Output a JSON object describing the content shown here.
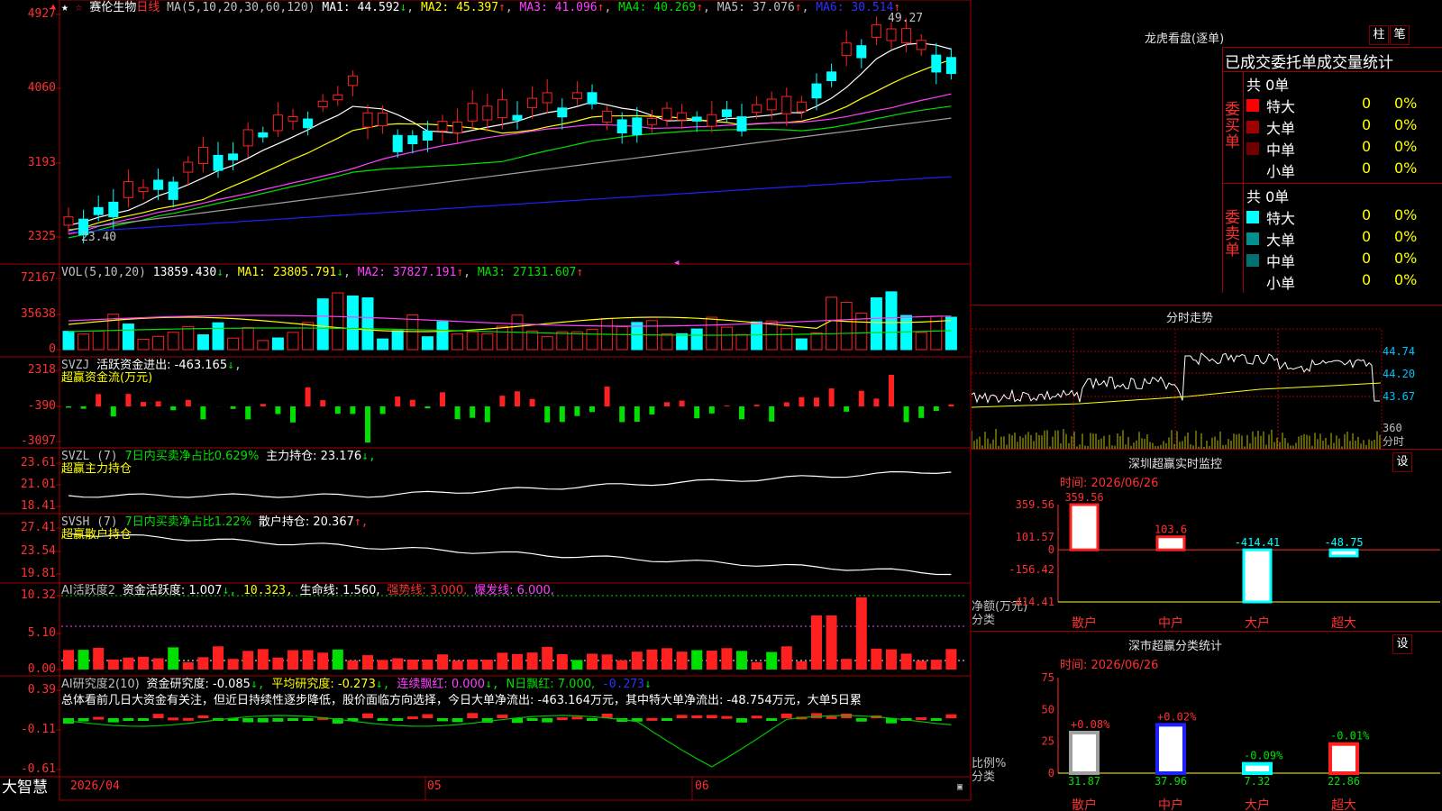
{
  "stock": {
    "name": "赛伦生物",
    "period": "日线",
    "ma_params": "MA(5,10,20,30,60,120)"
  },
  "main_header": {
    "ma1": "MA1: 44.592",
    "ma1_dir": "↓",
    "ma2": "MA2: 45.397",
    "ma2_dir": "↑",
    "ma3": "MA3: 41.096",
    "ma3_dir": "↑",
    "ma4": "MA4: 40.269",
    "ma4_dir": "↑",
    "ma5": "MA5: 37.076",
    "ma5_dir": "↑",
    "ma6": "MA6: 30.514",
    "ma6_dir": "↑",
    "high_label": "49.27",
    "low_label": "23.40"
  },
  "vol_header": {
    "params": "VOL(5,10,20)",
    "value": "13859.430",
    "dir": "↓",
    "ma1": "MA1: 23805.791",
    "ma1_dir": "↓",
    "ma2": "MA2: 37827.191",
    "ma2_dir": "↑",
    "ma3": "MA3: 27131.607",
    "ma3_dir": "↑"
  },
  "svzj_header": {
    "name": "SVZJ",
    "label": "活跃资金进出: -463.165",
    "dir": "↓",
    "sub": "超赢资金流(万元)"
  },
  "svzl_header": {
    "name": "SVZL (7)",
    "label": "7日内买卖净占比0.629%",
    "hold": "主力持仓: 23.176",
    "dir": "↓,",
    "sub": "超赢主力持仓"
  },
  "svsh_header": {
    "name": "SVSH (7)",
    "label": "7日内买卖净占比1.22%",
    "hold": "散户持仓: 20.367",
    "dir": "↑,",
    "sub": "超赢散户持仓"
  },
  "ai_header": {
    "name": "AI活跃度2",
    "a": "资金活跃度: 1.007",
    "a_dir": "↓,",
    "b": "10.323,",
    "c": "生命线: 1.560,",
    "d": "强势线: 3.000,",
    "e": "爆发线: 6.000,"
  },
  "ai2_header": {
    "name": "AI研究度2(10)",
    "a": "资金研究度: -0.085",
    "a_dir": "↓,",
    "b": "平均研究度: -0.273",
    "b_dir": "↓,",
    "c": "连续飘红: 0.000",
    "c_dir": "↓,",
    "d": "N日飘红: 7.000,",
    "e": "-0.273",
    "e_dir": "↓"
  },
  "ai2_text": "总体看前几日大资金有关注，但近日持续性逐步降低，股价面临方向选择，今日大单净流出: -463.164万元，其中特大单净流出: -48.754万元，大单5日累",
  "axes": {
    "main": [
      "4927",
      "4060",
      "3193",
      "2325"
    ],
    "vol": [
      "72167",
      "35638",
      "0"
    ],
    "svzj": [
      "2318",
      "-390",
      "-3097"
    ],
    "svzl": [
      "23.61",
      "21.01",
      "18.41"
    ],
    "svsh": [
      "27.41",
      "23.54",
      "19.81"
    ],
    "ai": [
      "10.32",
      "5.10",
      "0.00"
    ],
    "ai2": [
      "0.39",
      "-0.11",
      "-0.61"
    ]
  },
  "x_axis": {
    "d1": "2026/04",
    "d2": "05",
    "d3": "06"
  },
  "app_name": "大智慧",
  "right": {
    "title": "龙虎看盘(逐单)",
    "btn1": "柱",
    "btn2": "笔",
    "order_title": "已成交委托单成交量统计",
    "buy_label": "委买单",
    "sell_label": "委卖单",
    "buy_total": "共 0单",
    "sell_total": "共 0单",
    "buy_rows": [
      {
        "name": "特大",
        "v": "0",
        "p": "0%",
        "c": "#ff0000"
      },
      {
        "name": "大单",
        "v": "0",
        "p": "0%",
        "c": "#a00000"
      },
      {
        "name": "中单",
        "v": "0",
        "p": "0%",
        "c": "#700000"
      },
      {
        "name": "小单",
        "v": "0",
        "p": "0%",
        "c": ""
      }
    ],
    "sell_rows": [
      {
        "name": "特大",
        "v": "0",
        "p": "0%",
        "c": "#00ffff"
      },
      {
        "name": "大单",
        "v": "0",
        "p": "0%",
        "c": "#009090"
      },
      {
        "name": "中单",
        "v": "0",
        "p": "0%",
        "c": "#007070"
      },
      {
        "name": "小单",
        "v": "0",
        "p": "0%",
        "c": ""
      }
    ],
    "intraday_title": "分时走势",
    "intraday_axis": [
      "44.74",
      "44.20",
      "43.67"
    ],
    "intraday_vol": "360",
    "intraday_unit": "分时",
    "monitor_title": "深圳超赢实时监控",
    "monitor_btn": "设",
    "monitor_time": "时间: 2026/06/26",
    "monitor_axis": [
      "359.56",
      "101.57",
      "0",
      "-156.42",
      "-414.41"
    ],
    "monitor_unit1": "净额(万元)",
    "monitor_unit2": "分类",
    "monitor_cats": [
      "散户",
      "中户",
      "大户",
      "超大"
    ],
    "monitor_vals": [
      "359.56",
      "103.6",
      "-414.41",
      "-48.75"
    ],
    "stats_title": "深市超赢分类统计",
    "stats_btn": "设",
    "stats_time": "时间: 2026/06/26",
    "stats_axis": [
      "75",
      "50",
      "25",
      "0"
    ],
    "stats_unit1": "比例%",
    "stats_unit2": "分类",
    "stats_cats": [
      "散户",
      "中户",
      "大户",
      "超大"
    ],
    "stats_vals": [
      "31.87",
      "37.96",
      "7.32",
      "22.86"
    ],
    "stats_chg": [
      "+0.08%",
      "+0.02%",
      "-0.09%",
      "-0.01%"
    ]
  },
  "chart_data": [
    {
      "type": "bar",
      "title": "深圳超赢实时监控",
      "categories": [
        "散户",
        "中户",
        "大户",
        "超大"
      ],
      "values": [
        359.56,
        103.6,
        -414.41,
        -48.75
      ],
      "ylabel": "净额(万元)",
      "xlabel": "分类",
      "ylim": [
        -414.41,
        359.56
      ]
    },
    {
      "type": "bar",
      "title": "深市超赢分类统计",
      "categories": [
        "散户",
        "中户",
        "大户",
        "超大"
      ],
      "values": [
        31.87,
        37.96,
        7.32,
        22.86
      ],
      "ylabel": "比例%",
      "xlabel": "分类",
      "ylim": [
        0,
        75
      ]
    }
  ]
}
